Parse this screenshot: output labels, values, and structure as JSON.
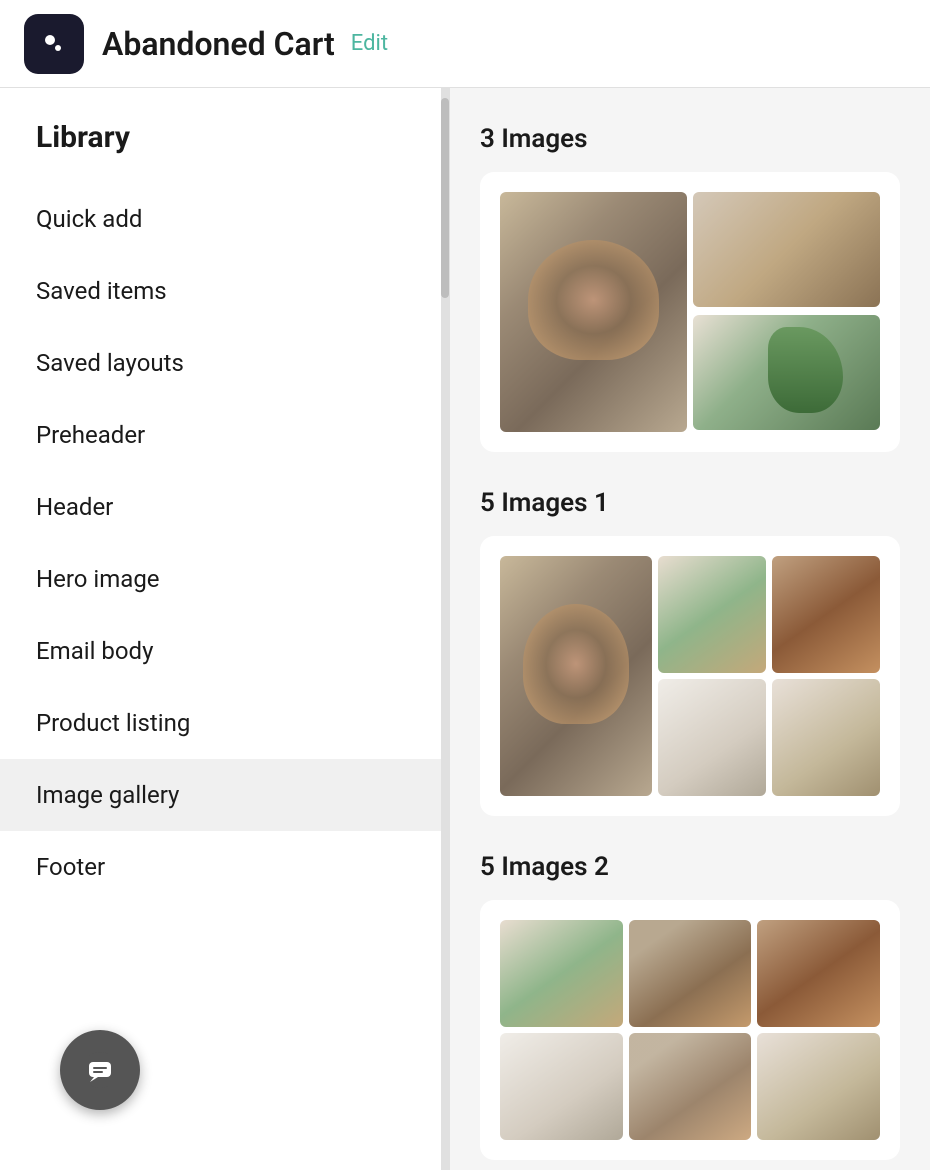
{
  "header": {
    "title": "Abandoned Cart",
    "edit_label": "Edit"
  },
  "sidebar": {
    "library_title": "Library",
    "items": [
      {
        "id": "quick-add",
        "label": "Quick add"
      },
      {
        "id": "saved-items",
        "label": "Saved items"
      },
      {
        "id": "saved-layouts",
        "label": "Saved layouts"
      },
      {
        "id": "preheader",
        "label": "Preheader"
      },
      {
        "id": "header",
        "label": "Header"
      },
      {
        "id": "hero-image",
        "label": "Hero image"
      },
      {
        "id": "email-body",
        "label": "Email body"
      },
      {
        "id": "product-listing",
        "label": "Product listing"
      },
      {
        "id": "image-gallery",
        "label": "Image gallery",
        "active": true
      },
      {
        "id": "footer",
        "label": "Footer"
      }
    ]
  },
  "content": {
    "sections": [
      {
        "id": "3-images",
        "title": "3 Images"
      },
      {
        "id": "5-images-1",
        "title": "5 Images 1"
      },
      {
        "id": "5-images-2",
        "title": "5 Images 2"
      }
    ]
  },
  "chat_button_label": "Chat"
}
